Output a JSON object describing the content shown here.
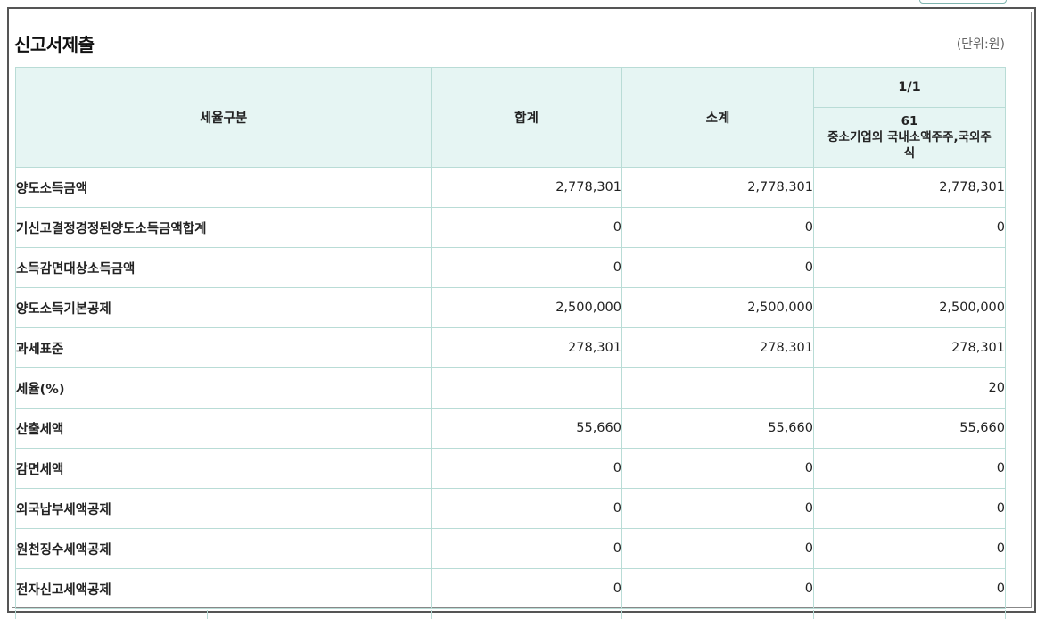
{
  "page": {
    "title": "신고서제출",
    "unit": "(단위:원)"
  },
  "table": {
    "headers": {
      "category": "세율구분",
      "total": "합계",
      "subtotal": "소계",
      "page": "1/1",
      "code": "61",
      "code_desc": "중소기업외 국내소액주주,국외주식"
    },
    "rows": [
      {
        "label": "양도소득금액",
        "total": "2,778,301",
        "subtotal": "2,778,301",
        "c1": "2,778,301"
      },
      {
        "label": "기신고결정경정된양도소득금액합계",
        "total": "0",
        "subtotal": "0",
        "c1": "0"
      },
      {
        "label": "소득감면대상소득금액",
        "total": "0",
        "subtotal": "0",
        "c1": ""
      },
      {
        "label": "양도소득기본공제",
        "total": "2,500,000",
        "subtotal": "2,500,000",
        "c1": "2,500,000"
      },
      {
        "label": "과세표준",
        "total": "278,301",
        "subtotal": "278,301",
        "c1": "278,301"
      },
      {
        "label": "세율(%)",
        "total": "",
        "subtotal": "",
        "c1": "20"
      },
      {
        "label": "산출세액",
        "total": "55,660",
        "subtotal": "55,660",
        "c1": "55,660"
      },
      {
        "label": "감면세액",
        "total": "0",
        "subtotal": "0",
        "c1": "0"
      },
      {
        "label": "외국납부세액공제",
        "total": "0",
        "subtotal": "0",
        "c1": "0"
      },
      {
        "label": "원천징수세액공제",
        "total": "0",
        "subtotal": "0",
        "c1": "0"
      },
      {
        "label": "전자신고세액공제",
        "total": "0",
        "subtotal": "0",
        "c1": "0"
      }
    ]
  }
}
